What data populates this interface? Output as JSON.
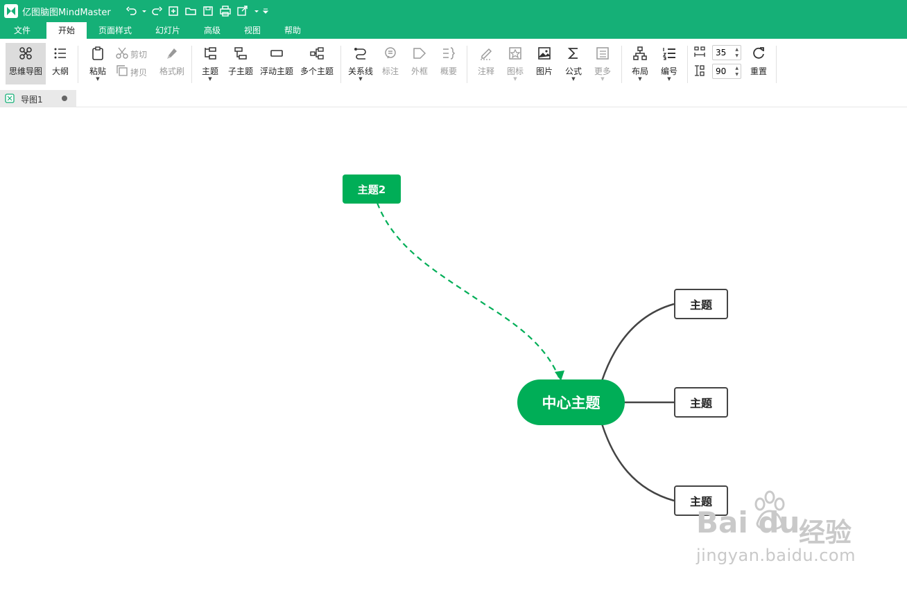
{
  "app": {
    "title": "亿图脑图MindMaster"
  },
  "menu": [
    "文件",
    "开始",
    "页面样式",
    "幻灯片",
    "高级",
    "视图",
    "帮助"
  ],
  "ribbon": {
    "mindmap": "思维导图",
    "outline": "大纲",
    "paste": "粘贴",
    "cut": "剪切",
    "copy": "拷贝",
    "format_painter": "格式刷",
    "topic": "主题",
    "subtopic": "子主题",
    "floating_topic": "浮动主题",
    "multiple_topics": "多个主题",
    "relationship": "关系线",
    "callout": "标注",
    "boundary": "外框",
    "summary": "概要",
    "note": "注释",
    "icon": "图标",
    "picture": "图片",
    "formula": "公式",
    "more": "更多",
    "layout": "布局",
    "numbering": "编号",
    "spacing_h": "35",
    "spacing_v": "90",
    "reset": "重置"
  },
  "document_tab": {
    "label": "导图1"
  },
  "mindmap": {
    "floating_topic": "主题2",
    "central_topic": "中心主题",
    "subtopics": [
      "主题",
      "主题",
      "主题"
    ]
  },
  "watermark": {
    "logo": "Bai du",
    "brand": "经验",
    "url": "jingyan.baidu.com"
  },
  "colors": {
    "accent": "#15b077",
    "node_green": "#00ae57",
    "branch_line": "#444444"
  },
  "icons": [
    "undo-icon",
    "redo-icon",
    "new-icon",
    "open-icon",
    "save-icon",
    "print-icon",
    "export-icon"
  ]
}
